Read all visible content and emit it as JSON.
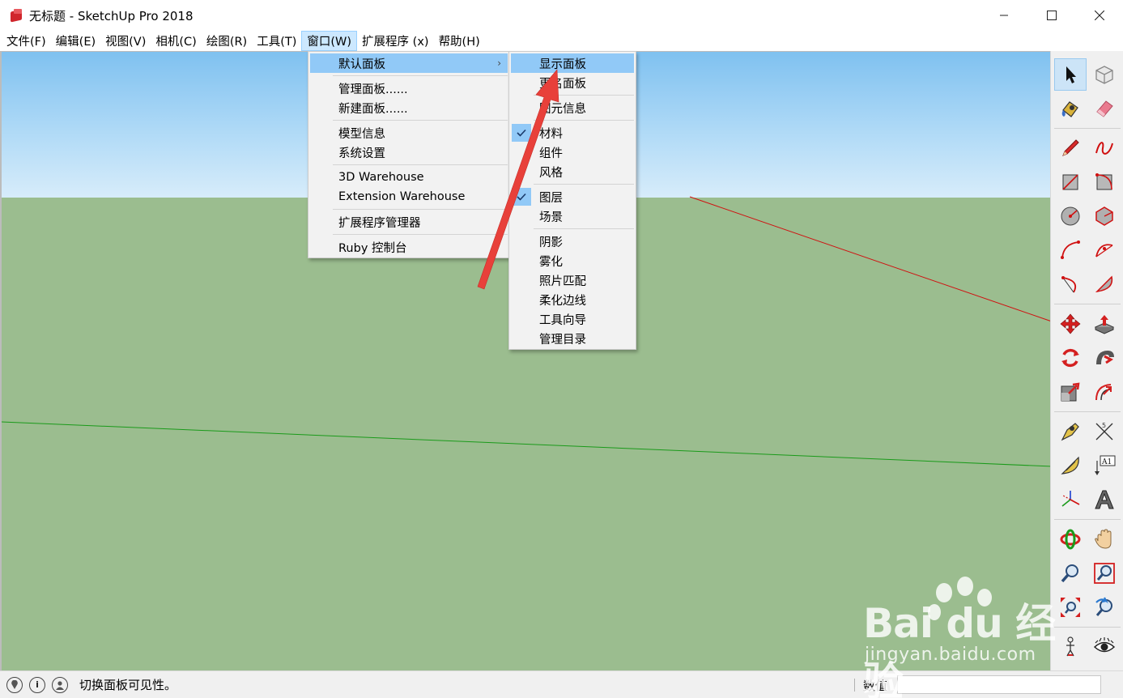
{
  "window": {
    "title": "无标题 - SketchUp Pro 2018",
    "minimize": "—",
    "maximize": "☐",
    "close": "✕"
  },
  "menubar": {
    "items": [
      {
        "label": "文件(F)"
      },
      {
        "label": "编辑(E)"
      },
      {
        "label": "视图(V)"
      },
      {
        "label": "相机(C)"
      },
      {
        "label": "绘图(R)"
      },
      {
        "label": "工具(T)"
      },
      {
        "label": "窗口(W)",
        "active": true
      },
      {
        "label": "扩展程序 (x)"
      },
      {
        "label": "帮助(H)"
      }
    ]
  },
  "window_menu": {
    "items": [
      {
        "label": "默认面板",
        "highlighted": true,
        "has_submenu": true
      },
      {
        "label": "管理面板......"
      },
      {
        "label": "新建面板......"
      },
      {
        "label": "模型信息"
      },
      {
        "label": "系统设置"
      },
      {
        "label": "3D Warehouse"
      },
      {
        "label": "Extension Warehouse"
      },
      {
        "label": "扩展程序管理器"
      },
      {
        "label": "Ruby 控制台"
      }
    ],
    "submenu_arrow": "›"
  },
  "default_panel_submenu": {
    "items": [
      {
        "label": "显示面板",
        "highlighted": true
      },
      {
        "label": "更名面板"
      },
      {
        "label": "图元信息"
      },
      {
        "label": "材料",
        "checked": true
      },
      {
        "label": "组件"
      },
      {
        "label": "风格"
      },
      {
        "label": "图层",
        "checked": true
      },
      {
        "label": "场景"
      },
      {
        "label": "阴影"
      },
      {
        "label": "雾化"
      },
      {
        "label": "照片匹配"
      },
      {
        "label": "柔化边线"
      },
      {
        "label": "工具向导"
      },
      {
        "label": "管理目录"
      }
    ]
  },
  "toolbar": {
    "tools": [
      "select-tool",
      "component-tool",
      "paint-bucket-tool",
      "eraser-tool",
      "line-tool",
      "freehand-tool",
      "rectangle-tool",
      "rotated-rectangle-tool",
      "circle-tool",
      "polygon-tool",
      "arc-tool",
      "two-point-arc-tool",
      "three-point-arc-tool",
      "pie-tool",
      "move-tool",
      "push-pull-tool",
      "rotate-tool",
      "follow-me-tool",
      "scale-tool",
      "offset-tool",
      "tape-measure-tool",
      "dimension-tool",
      "protractor-tool",
      "text-tool",
      "axes-tool",
      "3d-text-tool",
      "orbit-tool",
      "pan-tool",
      "zoom-tool",
      "zoom-window-tool",
      "zoom-extents-tool",
      "previous-view-tool",
      "position-camera-tool",
      "look-around-tool"
    ],
    "text_tool_label": "A1"
  },
  "statusbar": {
    "message": "切换面板可见性。",
    "measure_label": "数值",
    "measure_value": ""
  },
  "watermark": {
    "logo": "Bai  du 经验",
    "url": "jingyan.baidu.com"
  },
  "colors": {
    "menu_highlight": "#91c9f7",
    "menubar_active": "#cce8ff",
    "ground": "#9bbd8f",
    "sky_top": "#7fc1f0",
    "red_axis": "#d01010",
    "green_axis": "#1a9a1a",
    "annotation_arrow": "#e8403a"
  }
}
